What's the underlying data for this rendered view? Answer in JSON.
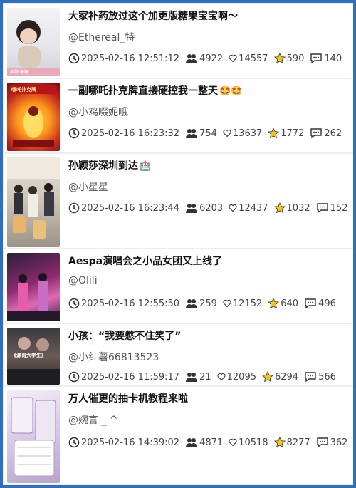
{
  "posts": [
    {
      "title": "大家补药放过这个加更版糖果宝宝啊～",
      "title_emoji": "",
      "author": "@Ethereal_特",
      "time": "2025-02-16 12:51:12",
      "views": "4922",
      "likes": "14557",
      "stars": "590",
      "comments": "140",
      "thumb_text": "美物  糖糖"
    },
    {
      "title": "一副哪吒扑克牌直接硬控我一整天",
      "title_emoji": "🤩🤩",
      "author": "@小鸡啜妮哦",
      "time": "2025-02-16 16:23:32",
      "views": "754",
      "likes": "13637",
      "stars": "1772",
      "comments": "262",
      "thumb_text": "哪吒扑克牌"
    },
    {
      "title": "孙颖莎深圳到达",
      "title_emoji": "🏥",
      "author": "@小星星",
      "time": "2025-02-16 16:23:44",
      "views": "6203",
      "likes": "12437",
      "stars": "1032",
      "comments": "152",
      "thumb_text": ""
    },
    {
      "title": "Aespa演唱会之小品女团又上线了",
      "title_emoji": "",
      "author": "@Olili",
      "time": "2025-02-16 12:55:50",
      "views": "259",
      "likes": "12152",
      "stars": "640",
      "comments": "496",
      "thumb_text": ""
    },
    {
      "title": "小孩：“我要憋不住笑了”",
      "title_emoji": "",
      "author": "@小红薯66813523",
      "time": "2025-02-16 11:59:17",
      "views": "21",
      "likes": "12095",
      "stars": "6294",
      "comments": "566",
      "thumb_text": "《渊哥大学生》"
    },
    {
      "title": "万人催更的抽卡机教程来啦",
      "title_emoji": "",
      "author": "@婉言 _ ^",
      "time": "2025-02-16 14:39:02",
      "views": "4871",
      "likes": "10518",
      "stars": "8277",
      "comments": "362",
      "thumb_text": ""
    }
  ],
  "colors": {
    "star": "#f5c518",
    "frame": "#2f6fbf"
  }
}
